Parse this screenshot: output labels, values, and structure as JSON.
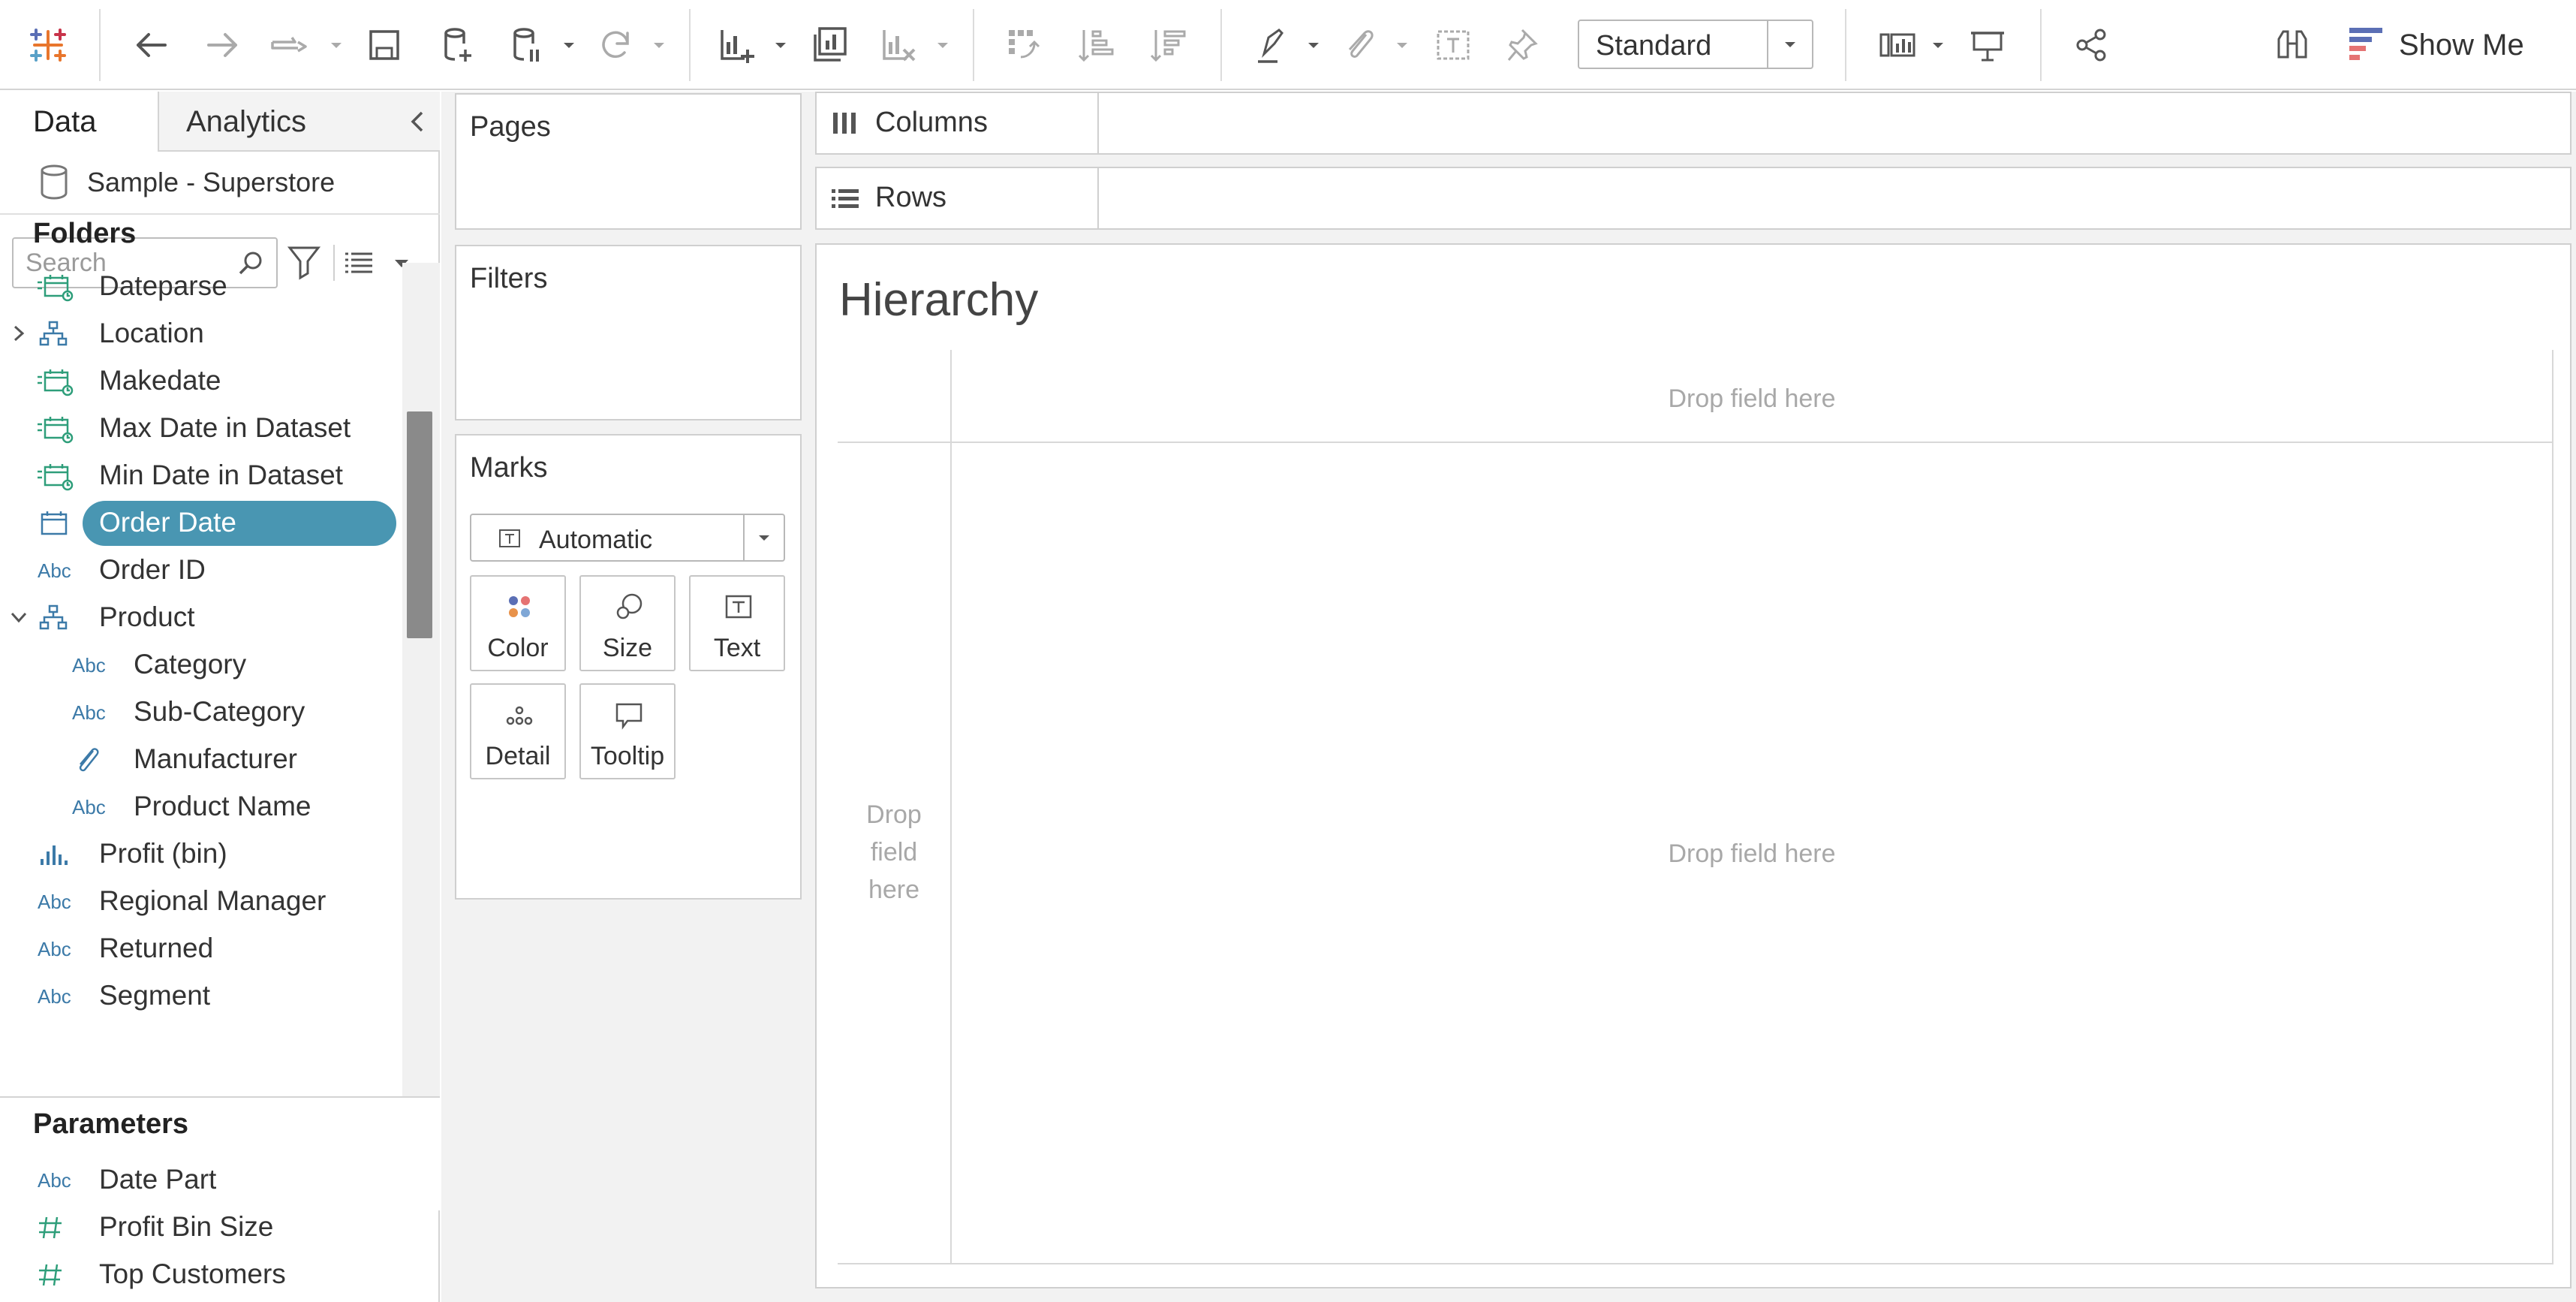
{
  "toolbar": {
    "fit_value": "Standard",
    "show_me_label": "Show Me"
  },
  "data_pane": {
    "tabs": {
      "data": "Data",
      "analytics": "Analytics"
    },
    "datasource": "Sample - Superstore",
    "search": {
      "placeholder": "Search",
      "value": ""
    },
    "folders_heading": "Folders",
    "fields": [
      {
        "name": "Dateparse",
        "icon": "calc-date-icon",
        "level": 0
      },
      {
        "name": "Location",
        "icon": "hierarchy-icon",
        "level": 0,
        "expander": "collapsed"
      },
      {
        "name": "Makedate",
        "icon": "calc-date-icon",
        "level": 0
      },
      {
        "name": "Max Date in Dataset",
        "icon": "calc-date-icon",
        "level": 0
      },
      {
        "name": "Min Date in Dataset",
        "icon": "calc-date-icon",
        "level": 0
      },
      {
        "name": "Order Date",
        "icon": "date-icon",
        "level": 0,
        "selected": true
      },
      {
        "name": "Order ID",
        "icon": "string-icon",
        "level": 0
      },
      {
        "name": "Product",
        "icon": "hierarchy-icon",
        "level": 0,
        "expander": "expanded"
      },
      {
        "name": "Category",
        "icon": "string-icon",
        "level": 1
      },
      {
        "name": "Sub-Category",
        "icon": "string-icon",
        "level": 1
      },
      {
        "name": "Manufacturer",
        "icon": "group-paperclip-icon",
        "level": 1
      },
      {
        "name": "Product Name",
        "icon": "string-icon",
        "level": 1
      },
      {
        "name": "Profit (bin)",
        "icon": "bin-icon",
        "level": 0
      },
      {
        "name": "Regional Manager",
        "icon": "string-icon",
        "level": 0
      },
      {
        "name": "Returned",
        "icon": "string-icon",
        "level": 0
      },
      {
        "name": "Segment",
        "icon": "string-icon",
        "level": 0
      }
    ],
    "abc_label": "Abc",
    "parameters_heading": "Parameters",
    "parameters": [
      {
        "name": "Date Part",
        "icon": "string-icon"
      },
      {
        "name": "Profit Bin Size",
        "icon": "number-param-icon"
      },
      {
        "name": "Top Customers",
        "icon": "number-param-icon"
      }
    ]
  },
  "cards": {
    "pages": "Pages",
    "filters": "Filters",
    "marks": "Marks",
    "mark_type": "Automatic",
    "mark_buttons": {
      "color": "Color",
      "size": "Size",
      "text": "Text",
      "detail": "Detail",
      "tooltip": "Tooltip"
    }
  },
  "shelves": {
    "columns": "Columns",
    "rows": "Rows"
  },
  "view": {
    "title": "Hierarchy",
    "drop_top": "Drop field here",
    "drop_left_1": "Drop",
    "drop_left_2": "field",
    "drop_left_3": "here",
    "drop_center": "Drop field here"
  },
  "colors": {
    "selected_pill": "#4996b2",
    "dimension_blue": "#3c7aa8",
    "measure_green": "#2e9e7a"
  }
}
